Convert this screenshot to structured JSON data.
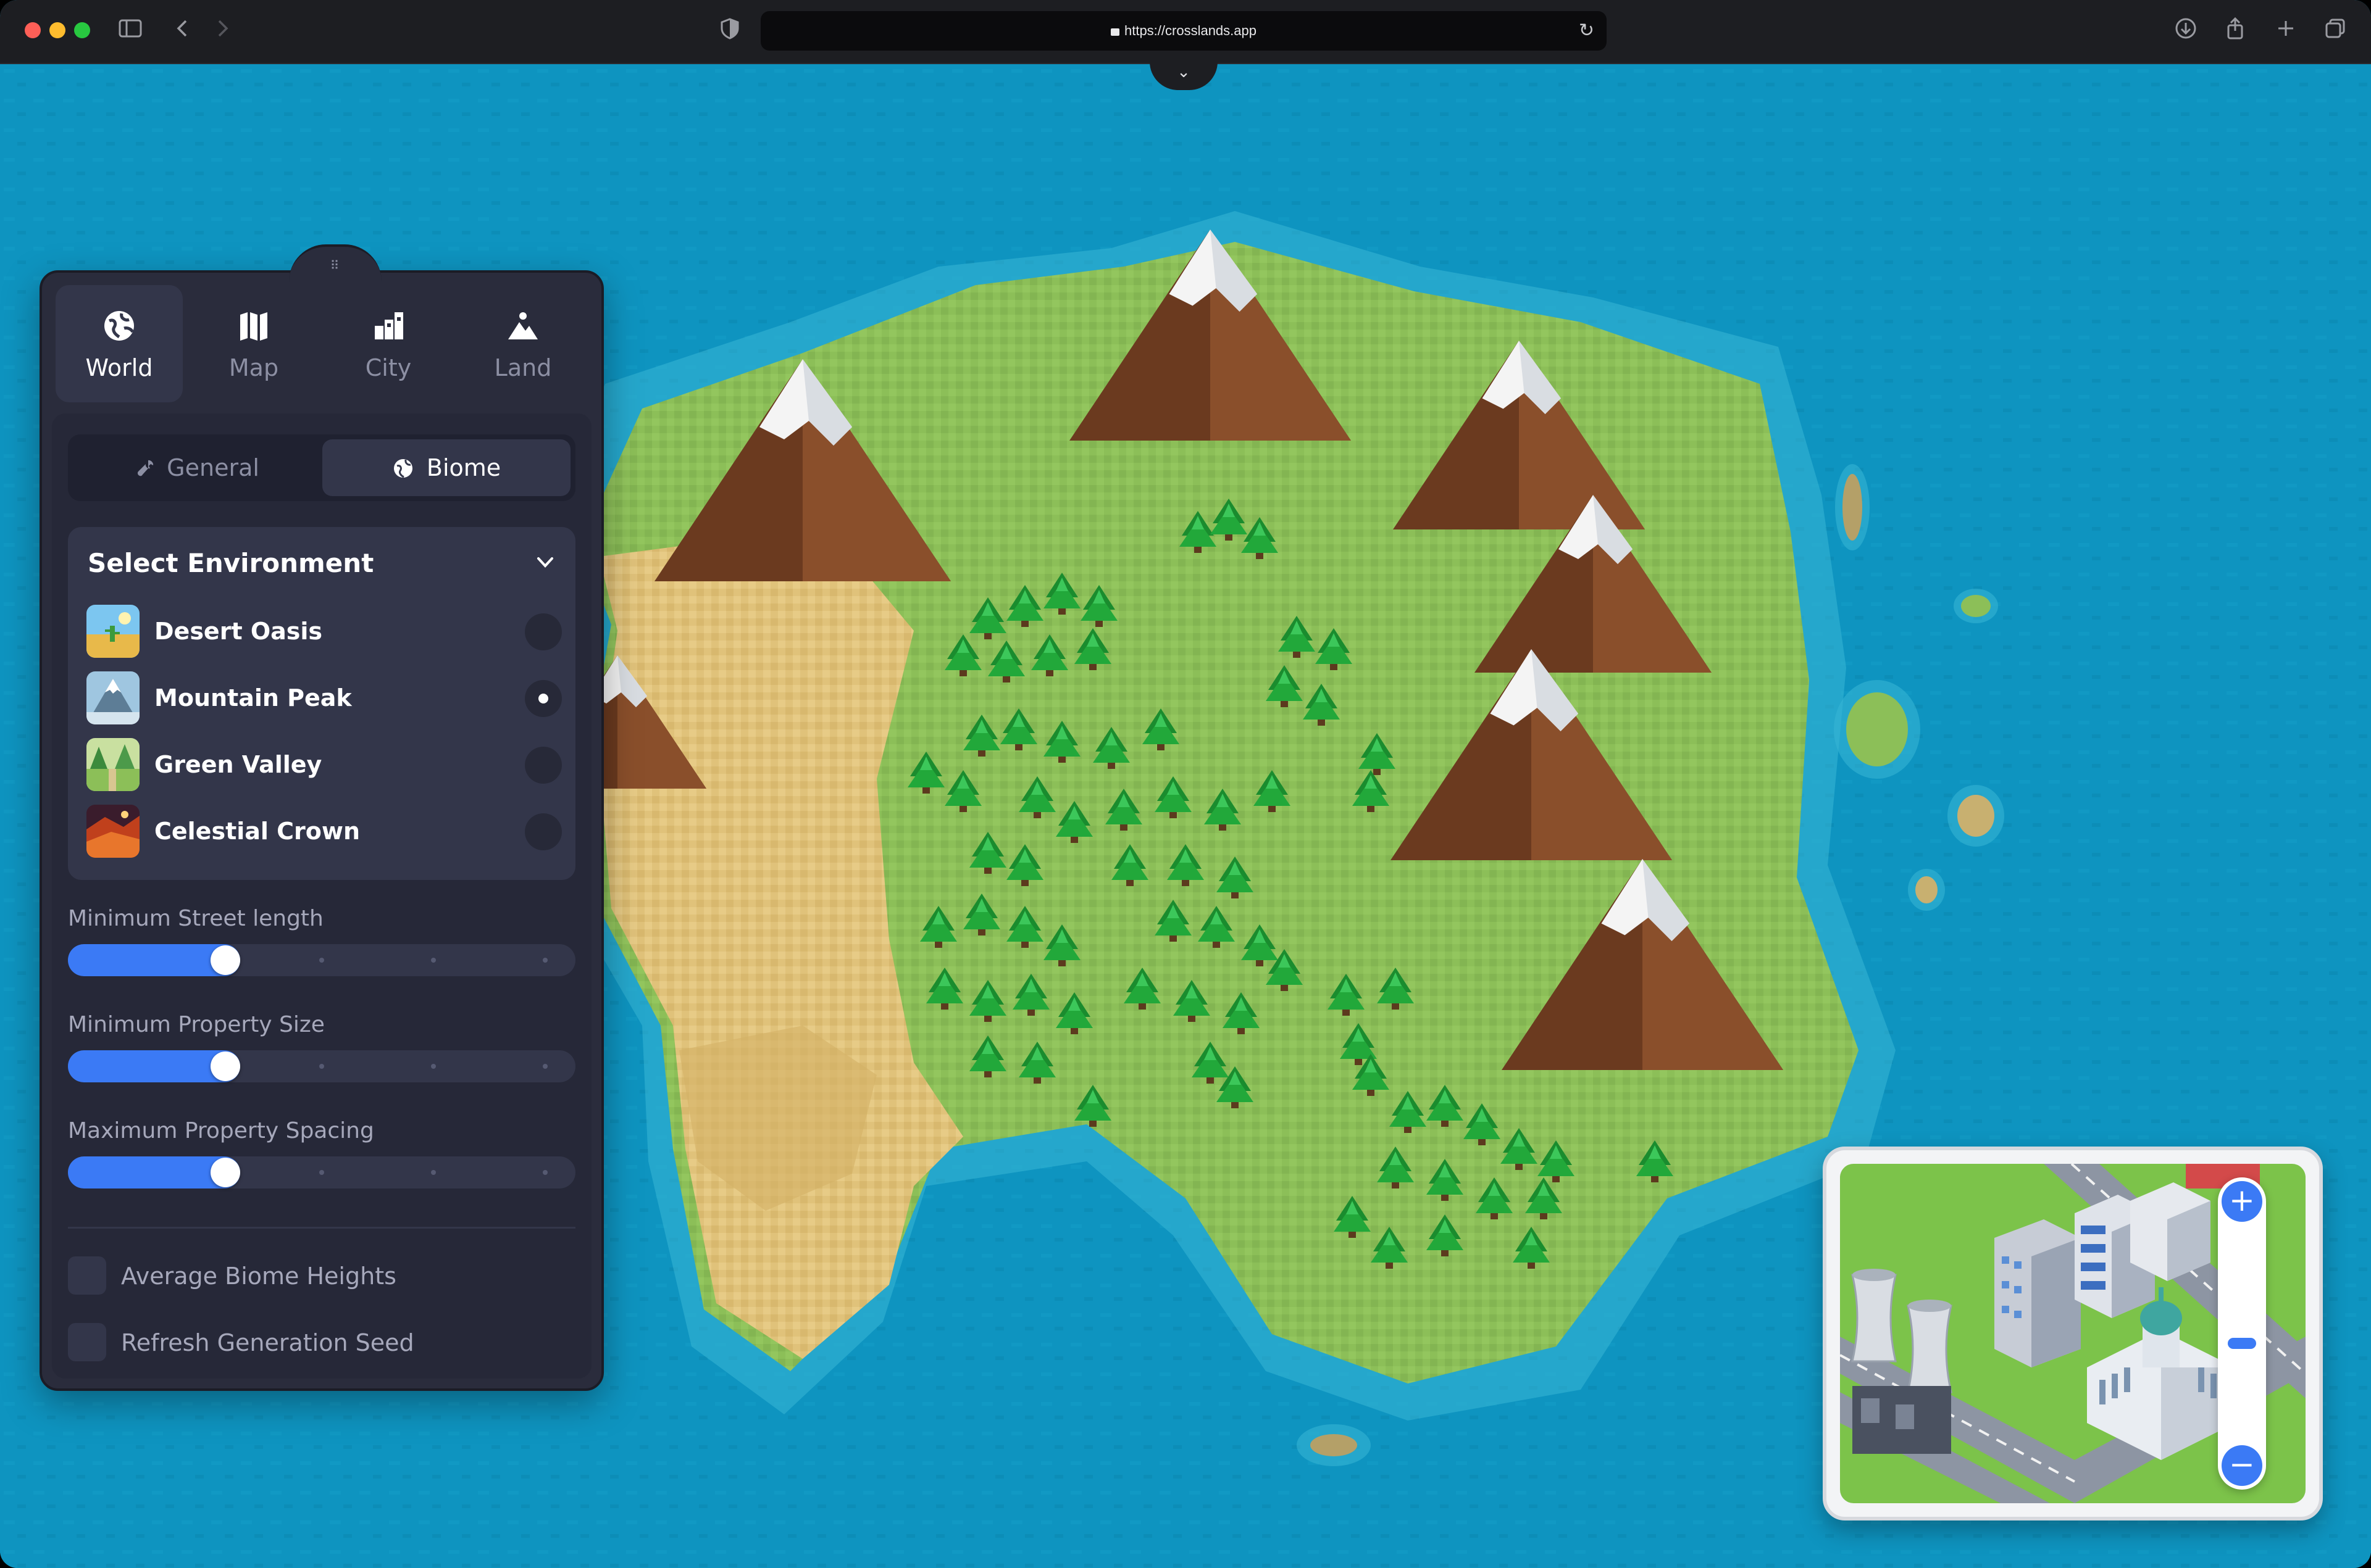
{
  "browser": {
    "url": "https://crosslands.app"
  },
  "panel": {
    "modes": [
      {
        "label": "World",
        "icon": "globe-icon",
        "active": true
      },
      {
        "label": "Map",
        "icon": "map-icon",
        "active": false
      },
      {
        "label": "City",
        "icon": "city-icon",
        "active": false
      },
      {
        "label": "Land",
        "icon": "landscape-icon",
        "active": false
      }
    ],
    "tabs": [
      {
        "label": "General",
        "icon": "wrench-icon",
        "active": false
      },
      {
        "label": "Biome",
        "icon": "globe-icon",
        "active": true
      }
    ],
    "environment": {
      "title": "Select Environment",
      "options": [
        {
          "label": "Desert Oasis",
          "selected": false
        },
        {
          "label": "Mountain Peak",
          "selected": true
        },
        {
          "label": "Green Valley",
          "selected": false
        },
        {
          "label": "Celestial Crown",
          "selected": false
        }
      ]
    },
    "sliders": [
      {
        "label": "Minimum Street length",
        "value": 0.31
      },
      {
        "label": "Minimum Property Size",
        "value": 0.31
      },
      {
        "label": "Maximum Property Spacing",
        "value": 0.31
      }
    ],
    "checkboxes": [
      {
        "label": "Average Biome Heights",
        "checked": false
      },
      {
        "label": "Refresh Generation Seed",
        "checked": false
      }
    ]
  },
  "minimap": {
    "zoom_in_label": "+",
    "zoom_out_label": "−",
    "zoom_level": 0.45
  },
  "colors": {
    "ocean": "#0e94c0",
    "accent": "#3b7af5",
    "panel_bg": "#2a2c3c"
  }
}
